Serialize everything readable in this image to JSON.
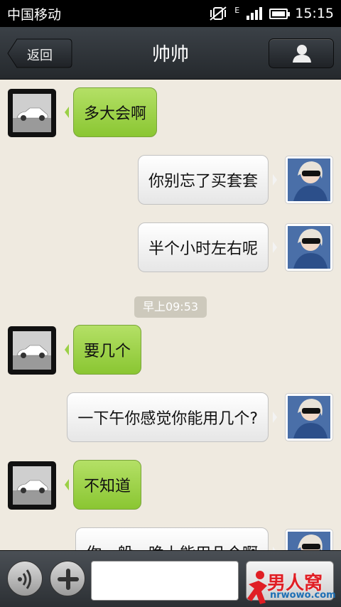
{
  "status": {
    "carrier": "中国移动",
    "network": "E",
    "time": "15:15"
  },
  "header": {
    "back_label": "返回",
    "title": "帅帅"
  },
  "messages": [
    {
      "from": "in",
      "text": "多大会啊"
    },
    {
      "from": "out",
      "text": "你别忘了买套套"
    },
    {
      "from": "out",
      "text": "半个小时左右呢"
    },
    {
      "from": "in",
      "text": "要几个"
    },
    {
      "from": "out",
      "text": "一下午你感觉你能用几个?"
    },
    {
      "from": "in",
      "text": "不知道"
    },
    {
      "from": "out",
      "text": "你一般一晚上能用几个啊"
    }
  ],
  "timestamp": "早上09:53",
  "input": {
    "value": "",
    "placeholder": ""
  },
  "watermark": {
    "title": "男人窝",
    "sub": "nrwowo.com"
  },
  "colors": {
    "incoming": "#9bd046",
    "outgoing": "#f3f3f3",
    "background": "#efeae0"
  }
}
